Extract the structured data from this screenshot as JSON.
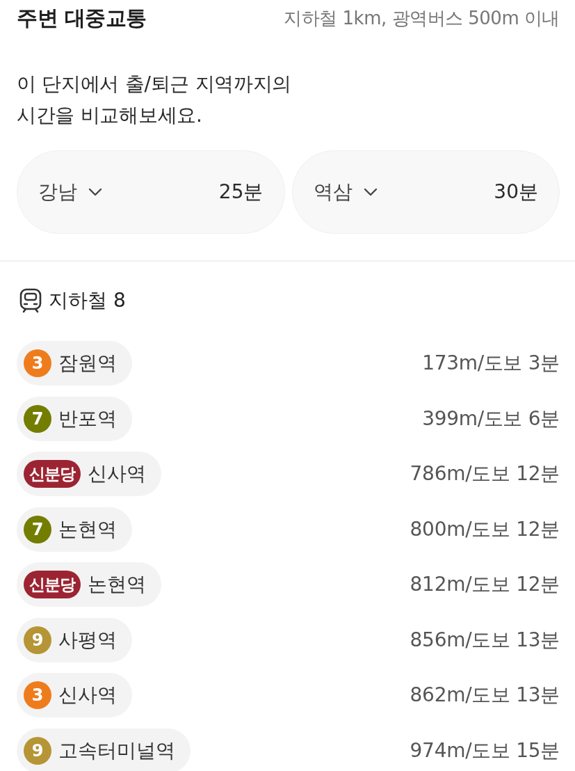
{
  "header": {
    "title": "주변 대중교통",
    "subtitle": "지하철 1km, 광역버스 500m 이내"
  },
  "description": "이 단지에서 출/퇴근 지역까지의\n시간을 비교해보세요.",
  "commute": [
    {
      "area": "강남",
      "time": "25분"
    },
    {
      "area": "역삼",
      "time": "30분"
    }
  ],
  "subway": {
    "title": "지하철 8",
    "stations": [
      {
        "kind": "circle",
        "line": "3",
        "color": "#ef7c1c",
        "name": "잠원역",
        "distance": "173m/도보 3분"
      },
      {
        "kind": "circle",
        "line": "7",
        "color": "#737d00",
        "name": "반포역",
        "distance": "399m/도보 6분"
      },
      {
        "kind": "pill",
        "line": "신분당",
        "color": "#9c2432",
        "name": "신사역",
        "distance": "786m/도보 12분"
      },
      {
        "kind": "circle",
        "line": "7",
        "color": "#737d00",
        "name": "논현역",
        "distance": "800m/도보 12분"
      },
      {
        "kind": "pill",
        "line": "신분당",
        "color": "#9c2432",
        "name": "논현역",
        "distance": "812m/도보 12분"
      },
      {
        "kind": "circle",
        "line": "9",
        "color": "#b59535",
        "name": "사평역",
        "distance": "856m/도보 13분"
      },
      {
        "kind": "circle",
        "line": "3",
        "color": "#ef7c1c",
        "name": "신사역",
        "distance": "862m/도보 13분"
      },
      {
        "kind": "circle",
        "line": "9",
        "color": "#b59535",
        "name": "고속터미널역",
        "distance": "974m/도보 15분"
      }
    ]
  }
}
